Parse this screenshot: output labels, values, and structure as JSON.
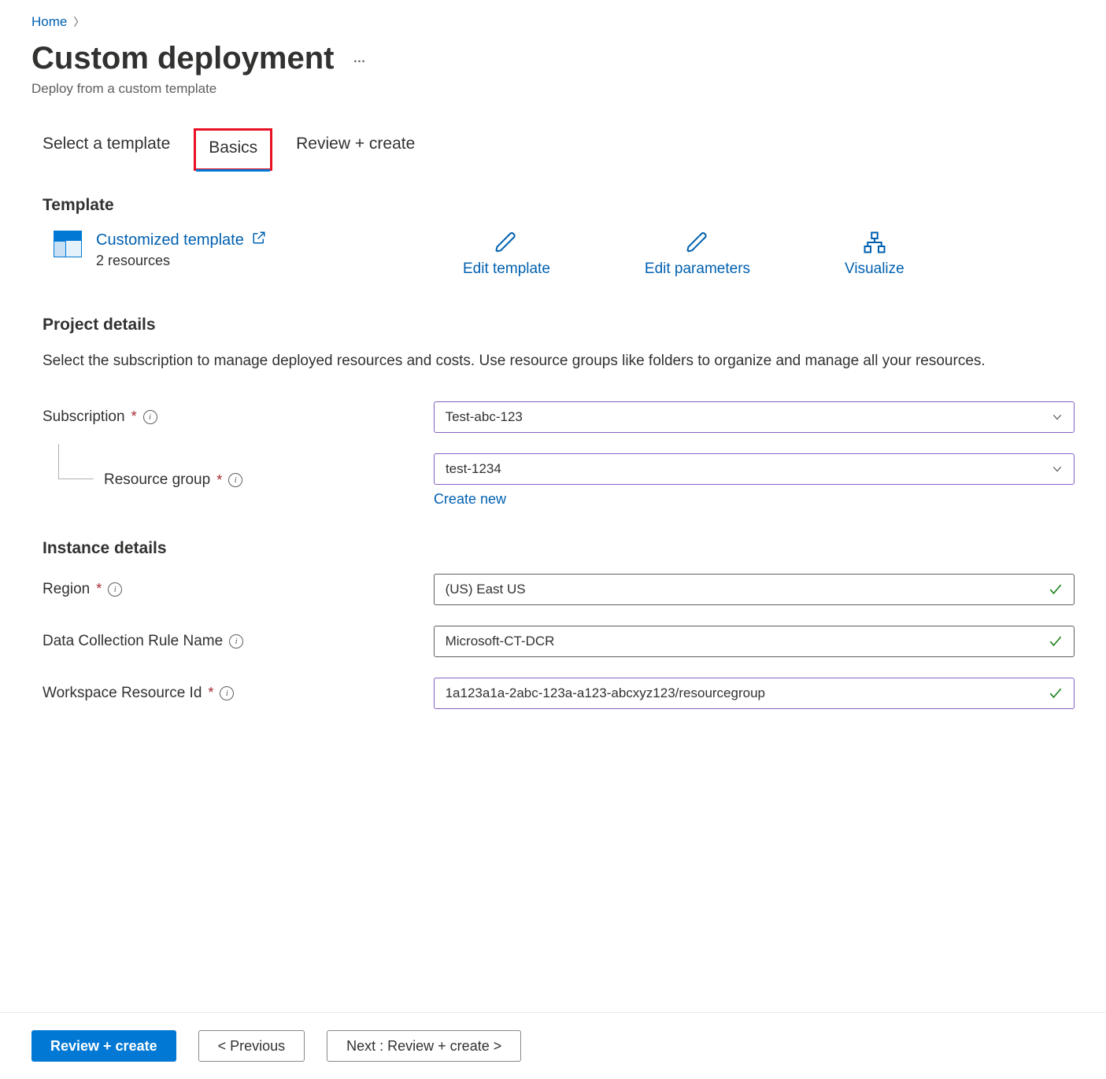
{
  "breadcrumb": {
    "home": "Home"
  },
  "page": {
    "title": "Custom deployment",
    "subtitle": "Deploy from a custom template",
    "more_icon": "…"
  },
  "tabs": {
    "select": "Select a template",
    "basics": "Basics",
    "review": "Review + create"
  },
  "template": {
    "heading": "Template",
    "link": "Customized template",
    "resources": "2 resources"
  },
  "actions": {
    "edit_template": "Edit template",
    "edit_parameters": "Edit parameters",
    "visualize": "Visualize"
  },
  "project": {
    "heading": "Project details",
    "description": "Select the subscription to manage deployed resources and costs. Use resource groups like folders to organize and manage all your resources.",
    "subscription_label": "Subscription",
    "subscription_value": "Test-abc-123",
    "resource_group_label": "Resource group",
    "resource_group_value": "test-1234",
    "create_new": "Create new"
  },
  "instance": {
    "heading": "Instance details",
    "region_label": "Region",
    "region_value": "(US) East US",
    "dcr_label": "Data Collection Rule Name",
    "dcr_value": "Microsoft-CT-DCR",
    "workspace_label": "Workspace Resource Id",
    "workspace_value": "1a123a1a-2abc-123a-a123-abcxyz123/resourcegroup"
  },
  "footer": {
    "review": "Review + create",
    "previous": "< Previous",
    "next": "Next : Review + create >"
  }
}
